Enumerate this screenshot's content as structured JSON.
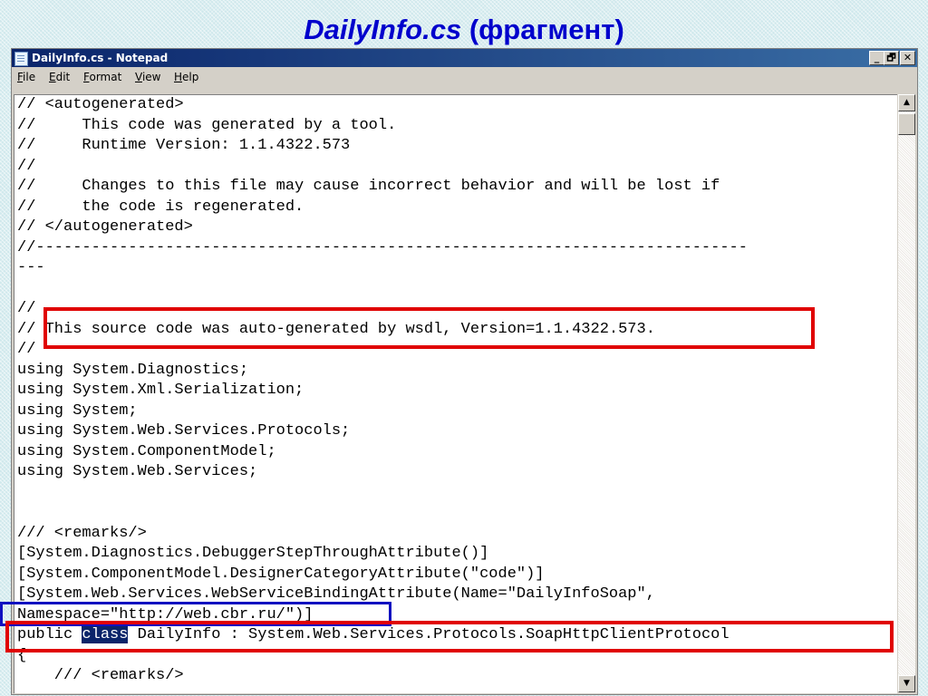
{
  "slide": {
    "title_file": "DailyInfo.cs",
    "title_note": "(фрагмент)"
  },
  "window": {
    "title": "DailyInfo.cs - Notepad",
    "buttons": {
      "minimize": "_",
      "maximize": "🗗",
      "close": "✕"
    }
  },
  "menu": {
    "items": [
      "File",
      "Edit",
      "Format",
      "View",
      "Help"
    ]
  },
  "editor": {
    "lines": [
      "// <autogenerated>",
      "//     This code was generated by a tool.",
      "//     Runtime Version: 1.1.4322.573",
      "//",
      "//     Changes to this file may cause incorrect behavior and will be lost if",
      "//     the code is regenerated.",
      "// </autogenerated>",
      "//-----------------------------------------------------------------------------",
      "---",
      "",
      "//",
      "// This source code was auto-generated by wsdl, Version=1.1.4322.573.",
      "//",
      "using System.Diagnostics;",
      "using System.Xml.Serialization;",
      "using System;",
      "using System.Web.Services.Protocols;",
      "using System.ComponentModel;",
      "using System.Web.Services;",
      "",
      "",
      "/// <remarks/>",
      "[System.Diagnostics.DebuggerStepThroughAttribute()]",
      "[System.ComponentModel.DesignerCategoryAttribute(\"code\")]",
      "[System.Web.Services.WebServiceBindingAttribute(Name=\"DailyInfoSoap\",",
      "Namespace=\"http://web.cbr.ru/\")]",
      "public class DailyInfo : System.Web.Services.Protocols.SoapHttpClientProtocol",
      "{",
      "    /// <remarks/>"
    ],
    "selection": {
      "line": 26,
      "text": "class"
    }
  },
  "scrollbar": {
    "up": "▲",
    "down": "▼"
  },
  "colors": {
    "title_blue": "#0000cc",
    "highlight_red": "#e00000",
    "highlight_blue": "#1010c0",
    "selection_bg": "#0a246a"
  }
}
